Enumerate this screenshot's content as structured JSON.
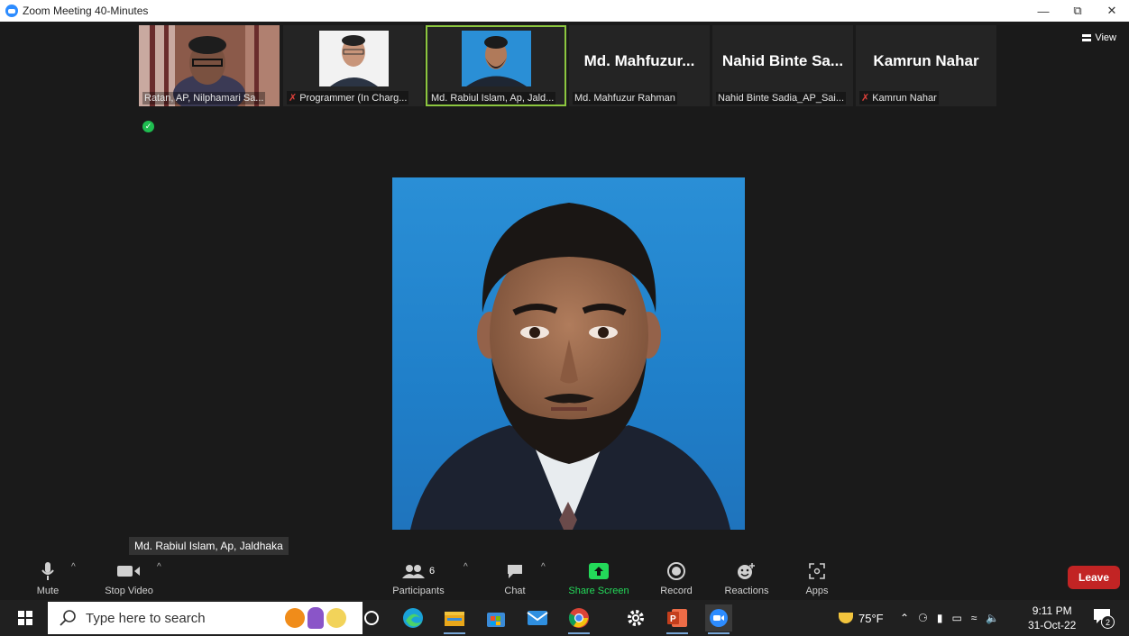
{
  "window": {
    "title": "Zoom Meeting 40-Minutes",
    "controls": [
      "minimize",
      "restore",
      "close"
    ]
  },
  "view_label": "View",
  "thumbnails": [
    {
      "name": "Ratan, AP, Nilphamari Sa...",
      "muted": false,
      "video": true
    },
    {
      "name": "Programmer (In Charg...",
      "muted": true,
      "video": true
    },
    {
      "name": "Md. Rabiul Islam, Ap, Jald...",
      "muted": false,
      "video": true,
      "active": true
    },
    {
      "name": "Md. Mahfuzur Rahman",
      "display": "Md. Mahfuzur...",
      "muted": false,
      "video": false
    },
    {
      "name": "Nahid Binte Sadia_AP_Sai...",
      "display": "Nahid Binte Sa...",
      "muted": false,
      "video": false
    },
    {
      "name": "Kamrun Nahar",
      "display": "Kamrun Nahar",
      "muted": true,
      "video": false
    }
  ],
  "active_speaker": {
    "name": "Md. Rabiul Islam, Ap, Jaldhaka"
  },
  "toolbar": {
    "mute": "Mute",
    "stop_video": "Stop Video",
    "participants": "Participants",
    "participants_count": "6",
    "chat": "Chat",
    "share_screen": "Share Screen",
    "record": "Record",
    "reactions": "Reactions",
    "apps": "Apps",
    "leave": "Leave"
  },
  "taskbar": {
    "search_placeholder": "Type here to search",
    "weather": "75°F",
    "time": "9:11 PM",
    "date": "31-Oct-22",
    "notification_count": "2"
  },
  "colors": {
    "share_green": "#23d959",
    "leave_red": "#c22424",
    "zoom_blue": "#2d8cff",
    "active_outline": "#8cc63f"
  }
}
